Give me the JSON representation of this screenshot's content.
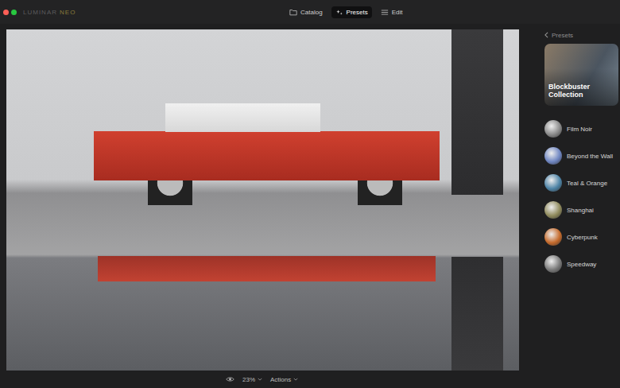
{
  "window": {
    "traffic_lights": [
      {
        "color": "#ff5f57"
      },
      {
        "color": "#28c840"
      }
    ]
  },
  "logo": {
    "brand": "LUMINAR",
    "suffix": "NEO"
  },
  "tabs": [
    {
      "label": "Catalog",
      "selected": false
    },
    {
      "label": "Presets",
      "selected": true
    },
    {
      "label": "Edit",
      "selected": false
    }
  ],
  "sidebar": {
    "back_label": "Presets",
    "collection": {
      "title": "Blockbuster Collection"
    },
    "items": [
      {
        "label": "Film Noir",
        "color": "#8a8a8a"
      },
      {
        "label": "Beyond the Wall",
        "color": "#6f86c2"
      },
      {
        "label": "Teal & Orange",
        "color": "#4d83a6"
      },
      {
        "label": "Shanghai",
        "color": "#8f8a5c"
      },
      {
        "label": "Cyberpunk",
        "color": "#c56a2b"
      },
      {
        "label": "Speedway",
        "color": "#7a7a7a"
      }
    ]
  },
  "bottom_bar": {
    "zoom": "23%",
    "actions": "Actions"
  }
}
